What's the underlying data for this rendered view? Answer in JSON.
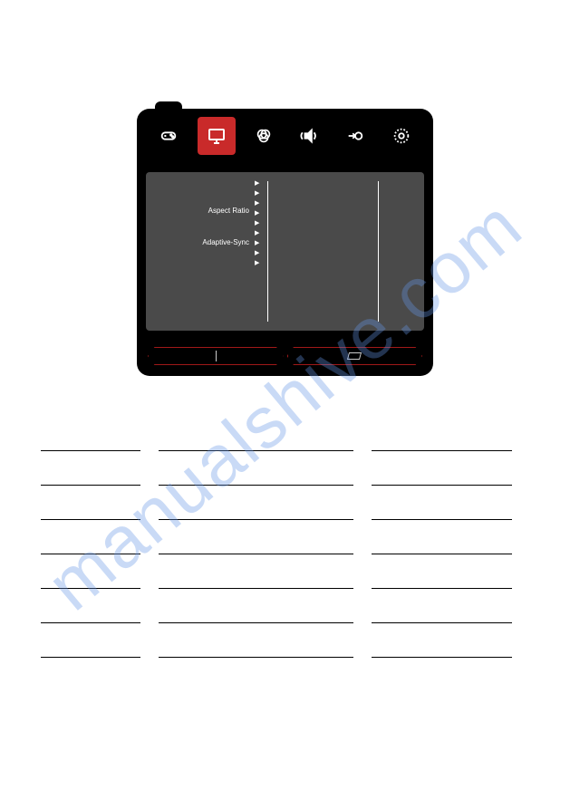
{
  "watermark": "manualshive.com",
  "osd": {
    "menu_items": [
      {
        "label": "Aspect Ratio"
      },
      {
        "label": "Adaptive-Sync"
      }
    ],
    "tabs": [
      {
        "name": "gamepad-icon",
        "active": false
      },
      {
        "name": "monitor-icon",
        "active": true
      },
      {
        "name": "color-icon",
        "active": false
      },
      {
        "name": "audio-icon",
        "active": false
      },
      {
        "name": "input-icon",
        "active": false
      },
      {
        "name": "settings-icon",
        "active": false
      }
    ]
  }
}
